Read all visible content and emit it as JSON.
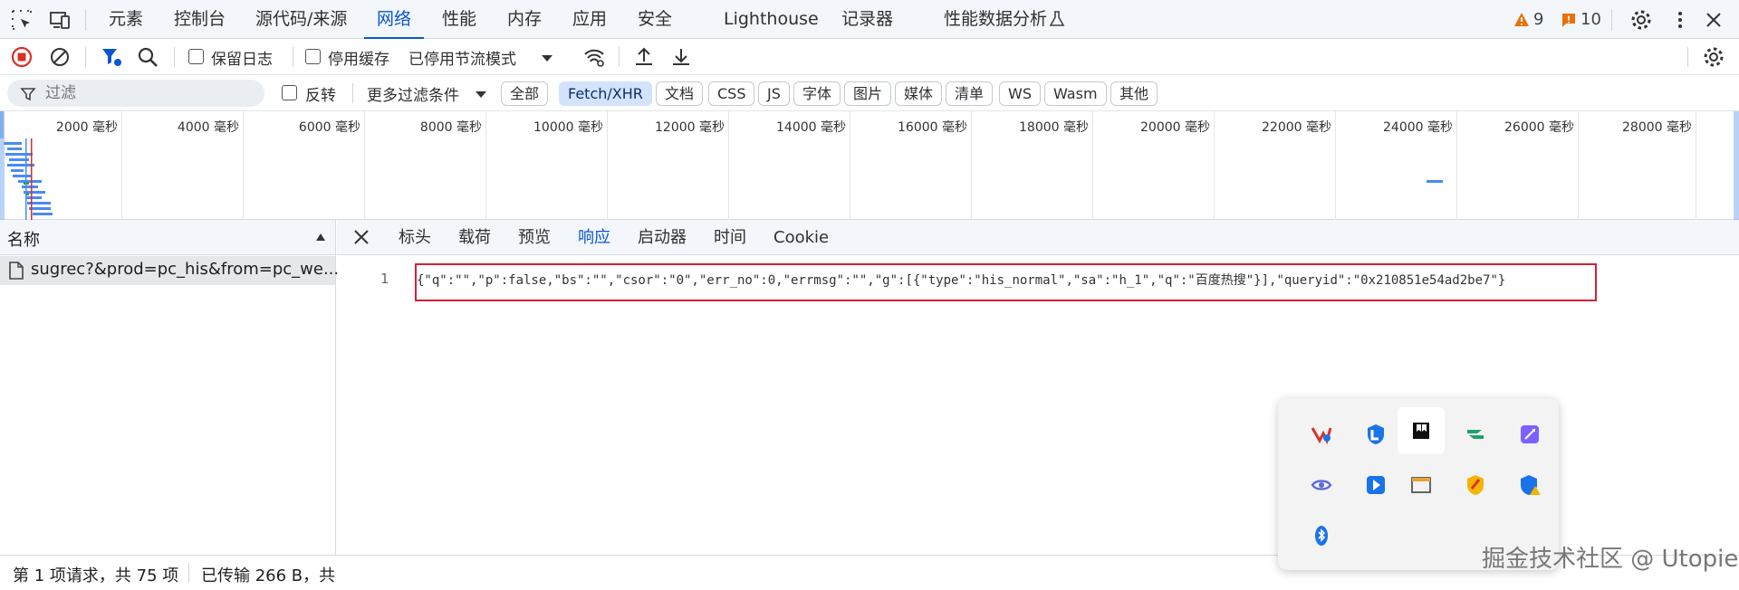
{
  "topbar": {
    "tabs": [
      "元素",
      "控制台",
      "源代码/来源",
      "网络",
      "性能",
      "内存",
      "应用",
      "安全",
      "Lighthouse",
      "记录器",
      "性能数据分析"
    ],
    "active_tab": "网络",
    "warnings_count": "9",
    "issues_count": "10"
  },
  "toolbar": {
    "preserve_log": "保留日志",
    "disable_cache": "停用缓存",
    "throttling": "已停用节流模式"
  },
  "filterbar": {
    "placeholder": "过滤",
    "invert": "反转",
    "more_filters": "更多过滤条件",
    "chips": [
      "全部",
      "Fetch/XHR",
      "文档",
      "CSS",
      "JS",
      "字体",
      "图片",
      "媒体",
      "清单",
      "WS",
      "Wasm",
      "其他"
    ],
    "active_chip": "Fetch/XHR"
  },
  "timeline": {
    "ticks": [
      "2000 毫秒",
      "4000 毫秒",
      "6000 毫秒",
      "8000 毫秒",
      "10000 毫秒",
      "12000 毫秒",
      "14000 毫秒",
      "16000 毫秒",
      "18000 毫秒",
      "20000 毫秒",
      "22000 毫秒",
      "24000 毫秒",
      "26000 毫秒",
      "28000 毫秒"
    ]
  },
  "request_list": {
    "column_name": "名称",
    "requests": [
      "sugrec?&prod=pc_his&from=pc_we..."
    ]
  },
  "details": {
    "tabs": [
      "标头",
      "载荷",
      "预览",
      "响应",
      "启动器",
      "时间",
      "Cookie"
    ],
    "active_tab": "响应",
    "line_number": "1",
    "response_text": "{\"q\":\"\",\"p\":false,\"bs\":\"\",\"csor\":\"0\",\"err_no\":0,\"errmsg\":\"\",\"g\":[{\"type\":\"his_normal\",\"sa\":\"h_1\",\"q\":\"百度热搜\"}],\"queryid\":\"0x210851e54ad2be7\"}"
  },
  "statusbar": {
    "requests": "第 1 项请求，共 75 项",
    "transferred": "已传输 266 B，共"
  },
  "watermark": "掘金技术社区 @ Utopie",
  "colors": {
    "accent": "#0b57d0",
    "highlight_border": "#d7202f",
    "record_red": "#d93025"
  }
}
